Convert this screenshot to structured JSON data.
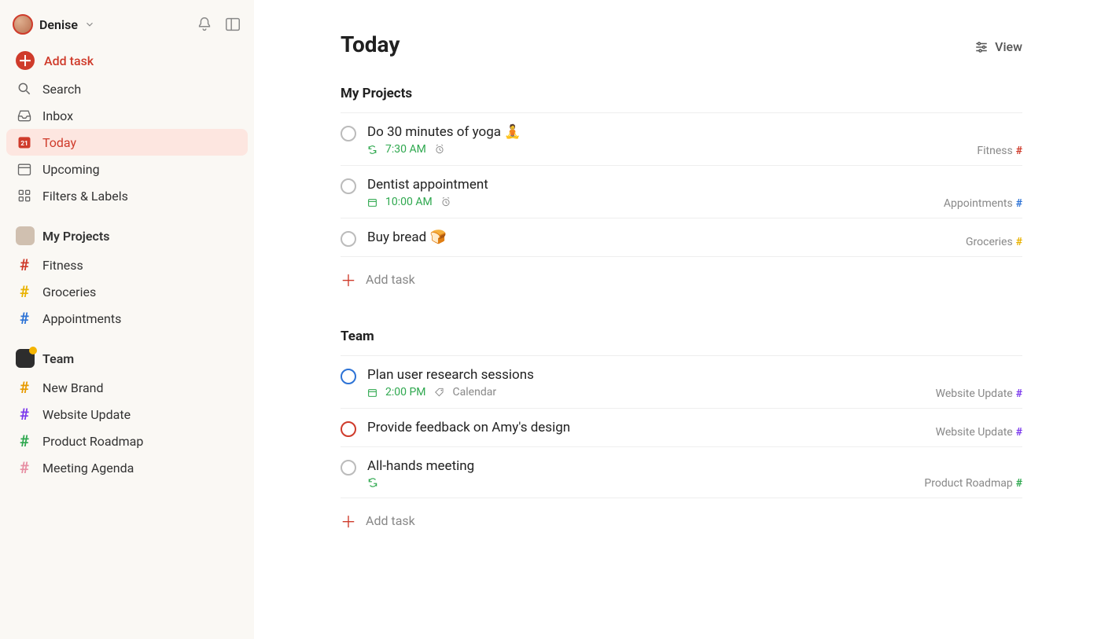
{
  "user": {
    "name": "Denise"
  },
  "sidebar": {
    "add_task": "Add task",
    "nav": [
      {
        "label": "Search",
        "icon": "search"
      },
      {
        "label": "Inbox",
        "icon": "inbox"
      },
      {
        "label": "Today",
        "icon": "calendar-day",
        "active": true
      },
      {
        "label": "Upcoming",
        "icon": "calendar"
      },
      {
        "label": "Filters & Labels",
        "icon": "grid"
      }
    ],
    "workspaces": [
      {
        "title": "My Projects",
        "avatar": "personal",
        "projects": [
          {
            "label": "Fitness",
            "color": "red"
          },
          {
            "label": "Groceries",
            "color": "yellow"
          },
          {
            "label": "Appointments",
            "color": "blue"
          }
        ]
      },
      {
        "title": "Team",
        "avatar": "team",
        "projects": [
          {
            "label": "New Brand",
            "color": "orange"
          },
          {
            "label": "Website Update",
            "color": "purple"
          },
          {
            "label": "Product Roadmap",
            "color": "green"
          },
          {
            "label": "Meeting Agenda",
            "color": "pink"
          }
        ]
      }
    ]
  },
  "main": {
    "page_title": "Today",
    "view_label": "View",
    "add_task_label": "Add task",
    "groups": [
      {
        "title": "My Projects",
        "tasks": [
          {
            "title": "Do 30 minutes of yoga 🧘",
            "priority": "none",
            "meta_time": "7:30 AM",
            "meta_recurring": true,
            "meta_reminder": true,
            "project": "Fitness",
            "project_color": "red"
          },
          {
            "title": "Dentist appointment",
            "priority": "none",
            "meta_time": "10:00 AM",
            "meta_date_icon": true,
            "meta_reminder": true,
            "project": "Appointments",
            "project_color": "blue"
          },
          {
            "title": "Buy bread 🍞",
            "priority": "none",
            "project": "Groceries",
            "project_color": "yellow"
          }
        ]
      },
      {
        "title": "Team",
        "tasks": [
          {
            "title": "Plan user research sessions",
            "priority": "blue",
            "meta_time": "2:00 PM",
            "meta_date_icon": true,
            "meta_label": "Calendar",
            "project": "Website Update",
            "project_color": "purple"
          },
          {
            "title": "Provide feedback on Amy's design",
            "priority": "red",
            "project": "Website Update",
            "project_color": "purple"
          },
          {
            "title": "All-hands meeting",
            "priority": "none",
            "meta_recurring": true,
            "project": "Product Roadmap",
            "project_color": "green"
          }
        ]
      }
    ]
  }
}
